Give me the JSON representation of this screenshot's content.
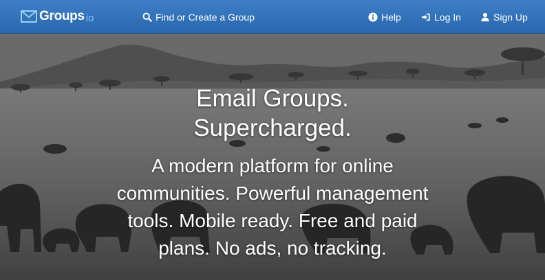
{
  "brand": {
    "name": "Groups",
    "tld": "io"
  },
  "nav": {
    "find": "Find or Create a Group",
    "help": "Help",
    "login": "Log In",
    "signup": "Sign Up"
  },
  "hero": {
    "headline_lines": [
      "Email Groups.",
      "Supercharged."
    ],
    "tagline_lines": [
      "A modern platform for online",
      "communities. Powerful management",
      "tools. Mobile ready. Free and paid",
      "plans. No ads, no tracking."
    ]
  },
  "colors": {
    "navbar": "#2f6fb8",
    "brand_tld": "#8fc2f0",
    "text": "#ffffff"
  },
  "icons": [
    "envelope-icon",
    "search-icon",
    "info-circle-icon",
    "sign-in-icon",
    "user-icon"
  ]
}
